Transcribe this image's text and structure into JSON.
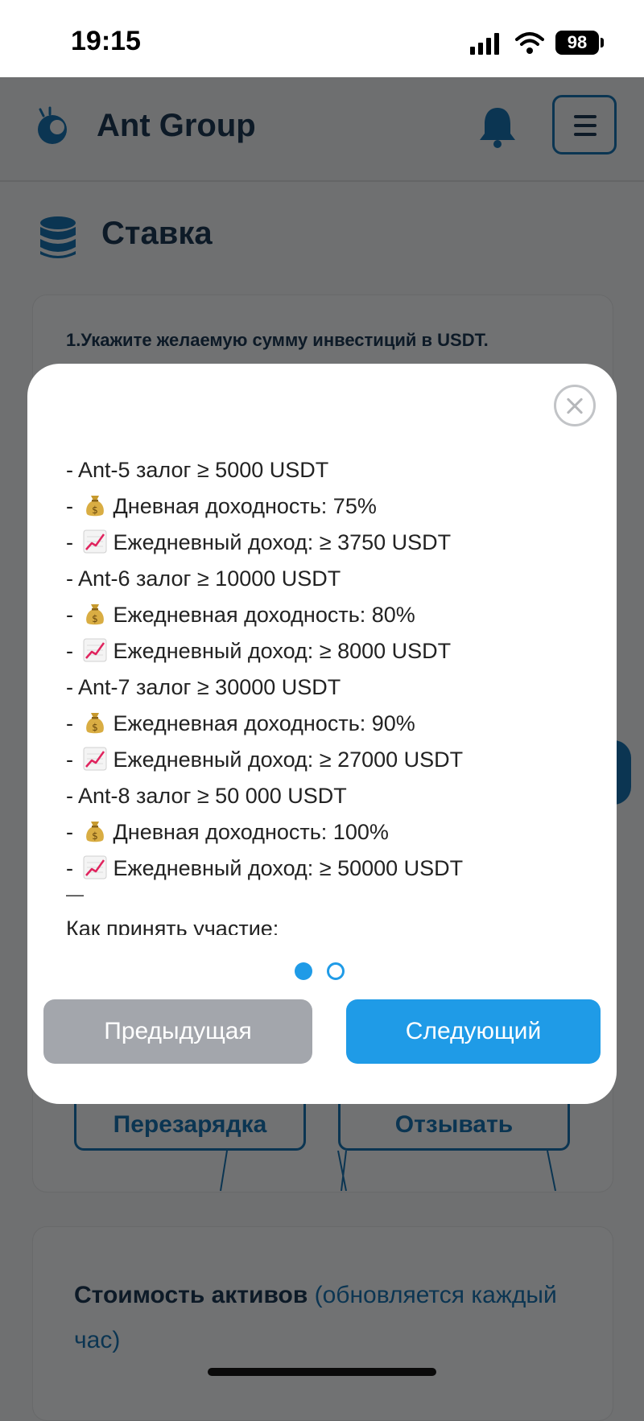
{
  "status_bar": {
    "time": "19:15",
    "battery": "98"
  },
  "header": {
    "app_title": "Ant Group"
  },
  "page": {
    "section_title": "Ставка",
    "instruction": "1.Укажите желаемую сумму инвестиций в USDT."
  },
  "background_buttons": {
    "recharge": "Перезарядка",
    "withdraw": "Отзывать"
  },
  "assets": {
    "title": "Стоимость активов",
    "note": "(обновляется каждый час)"
  },
  "modal": {
    "lines": [
      {
        "text": "- Ant-5 залог ≥ 5000 USDT",
        "icon": ""
      },
      {
        "text": "Дневная доходность: 75%",
        "icon": "money-bag"
      },
      {
        "text": "Ежедневный доход: ≥ 3750 USDT",
        "icon": "chart-increasing"
      },
      {
        "text": "- Ant-6 залог ≥ 10000 USDT",
        "icon": ""
      },
      {
        "text": "Ежедневная доходность: 80%",
        "icon": "money-bag"
      },
      {
        "text": "Ежедневный доход: ≥ 8000 USDT",
        "icon": "chart-increasing"
      },
      {
        "text": "- Ant-7 залог ≥ 30000 USDT",
        "icon": ""
      },
      {
        "text": "Ежедневная доходность: 90%",
        "icon": "money-bag"
      },
      {
        "text": "Ежедневный доход: ≥ 27000 USDT",
        "icon": "chart-increasing"
      },
      {
        "text": "- Ant-8 залог ≥ 50 000 USDT",
        "icon": ""
      },
      {
        "text": "Дневная доходность: 100%",
        "icon": "money-bag"
      },
      {
        "text": "Ежедневный доход: ≥ 50000 USDT",
        "icon": "chart-increasing"
      }
    ],
    "divider": "—",
    "participate": "Как принять участие:",
    "prev_label": "Предыдущая",
    "next_label": "Следующий",
    "page_count": 2,
    "current_page": 1
  },
  "colors": {
    "accent": "#1f9be7",
    "disabled": "#a3a6ac",
    "overlay": "#6f7071",
    "navy": "#0b3552"
  }
}
